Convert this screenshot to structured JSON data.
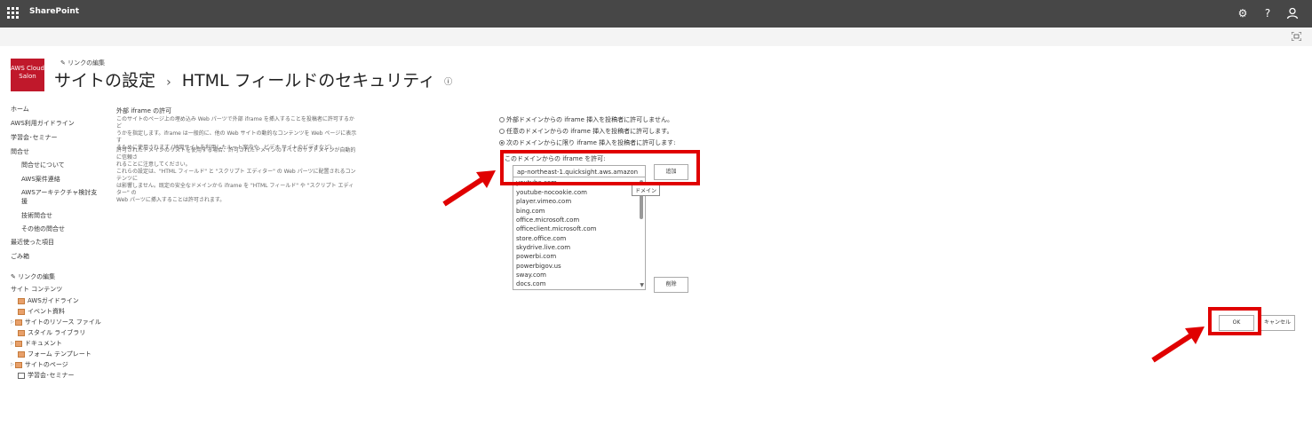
{
  "suite": {
    "app_name": "SharePoint",
    "icons": [
      "waffle-icon",
      "gear-icon",
      "help-icon",
      "user-icon"
    ],
    "help_label": "?"
  },
  "header": {
    "logo_line1": "AWS Cloud",
    "logo_line2": "Salon",
    "edit_links": "リンクの編集",
    "title_part1": "サイトの設定",
    "title_sep": "›",
    "title_part2": "HTML フィールドのセキュリティ",
    "info": "ⓘ"
  },
  "leftnav": {
    "items": [
      "ホーム",
      "AWS利用ガイドライン",
      "学習会･セミナー",
      "問合せ",
      "問合せについて",
      "AWS案件連絡",
      "AWSアーキテクチャ検討支",
      "援",
      "技術問合せ",
      "その他の問合せ",
      "最近使った項目",
      "ごみ箱"
    ],
    "edit_links": "リンクの編集",
    "site_contents": "サイト コンテンツ",
    "contents": [
      "AWSガイドライン",
      "イベント資料",
      "サイトのリソース ファイル",
      "スタイル ライブラリ",
      "ドキュメント",
      "フォーム テンプレート",
      "サイトのページ",
      "学習会･セミナー"
    ]
  },
  "description": {
    "title": "外部 iframe の許可",
    "para1": [
      "このサイトのページ上の埋め込み Web パーツで外部 iframe を挿入することを投稿者に許可するかど",
      "うかを指定します。iframe は一般的に、他の Web サイトの動的なコンテンツを Web ページに表示す",
      "るために使用されます (地図サイトを利用したルート案内や、ビデオ サイトのビデオなど)。"
    ],
    "para2": [
      "許可されたドメインのリストを使用する場合、許可されたドメインのすべてのサブドメインが自動的に信頼さ",
      "れることに注意してください。"
    ],
    "para3": [
      "これらの設定は、\"HTML フィールド\" と \"スクリプト エディター\" の Web パーツに配置されるコンテンツに",
      "は影響しません。既定の安全なドメインから iframe を \"HTML フィールド\" や \"スクリプト エディター\" の",
      "Web パーツに挿入することは許可されます。"
    ]
  },
  "options": {
    "radio1": "外部ドメインからの iframe 挿入を投稿者に許可しません。",
    "radio2": "任意のドメインからの iframe 挿入を投稿者に許可します。",
    "radio3": "次のドメインからに限り iframe 挿入を投稿者に許可します:",
    "selected_index": 2,
    "allow_label": "このドメインからの iframe を許可:",
    "domain_value": "ap-northeast-1.quicksight.aws.amazon",
    "add_label": "追加",
    "tooltip": "ドメイン",
    "domains": [
      "youtube.com",
      "youtube-nocookie.com",
      "player.vimeo.com",
      "bing.com",
      "office.microsoft.com",
      "officeclient.microsoft.com",
      "store.office.com",
      "skydrive.live.com",
      "powerbi.com",
      "powerbigov.us",
      "sway.com",
      "docs.com"
    ],
    "delete_label": "削除"
  },
  "actions": {
    "ok_label": "OK",
    "cancel_label": "キャンセル"
  },
  "colors": {
    "suitebar": "#474747",
    "highlight": "#e00000",
    "logo": "#c0182b"
  }
}
